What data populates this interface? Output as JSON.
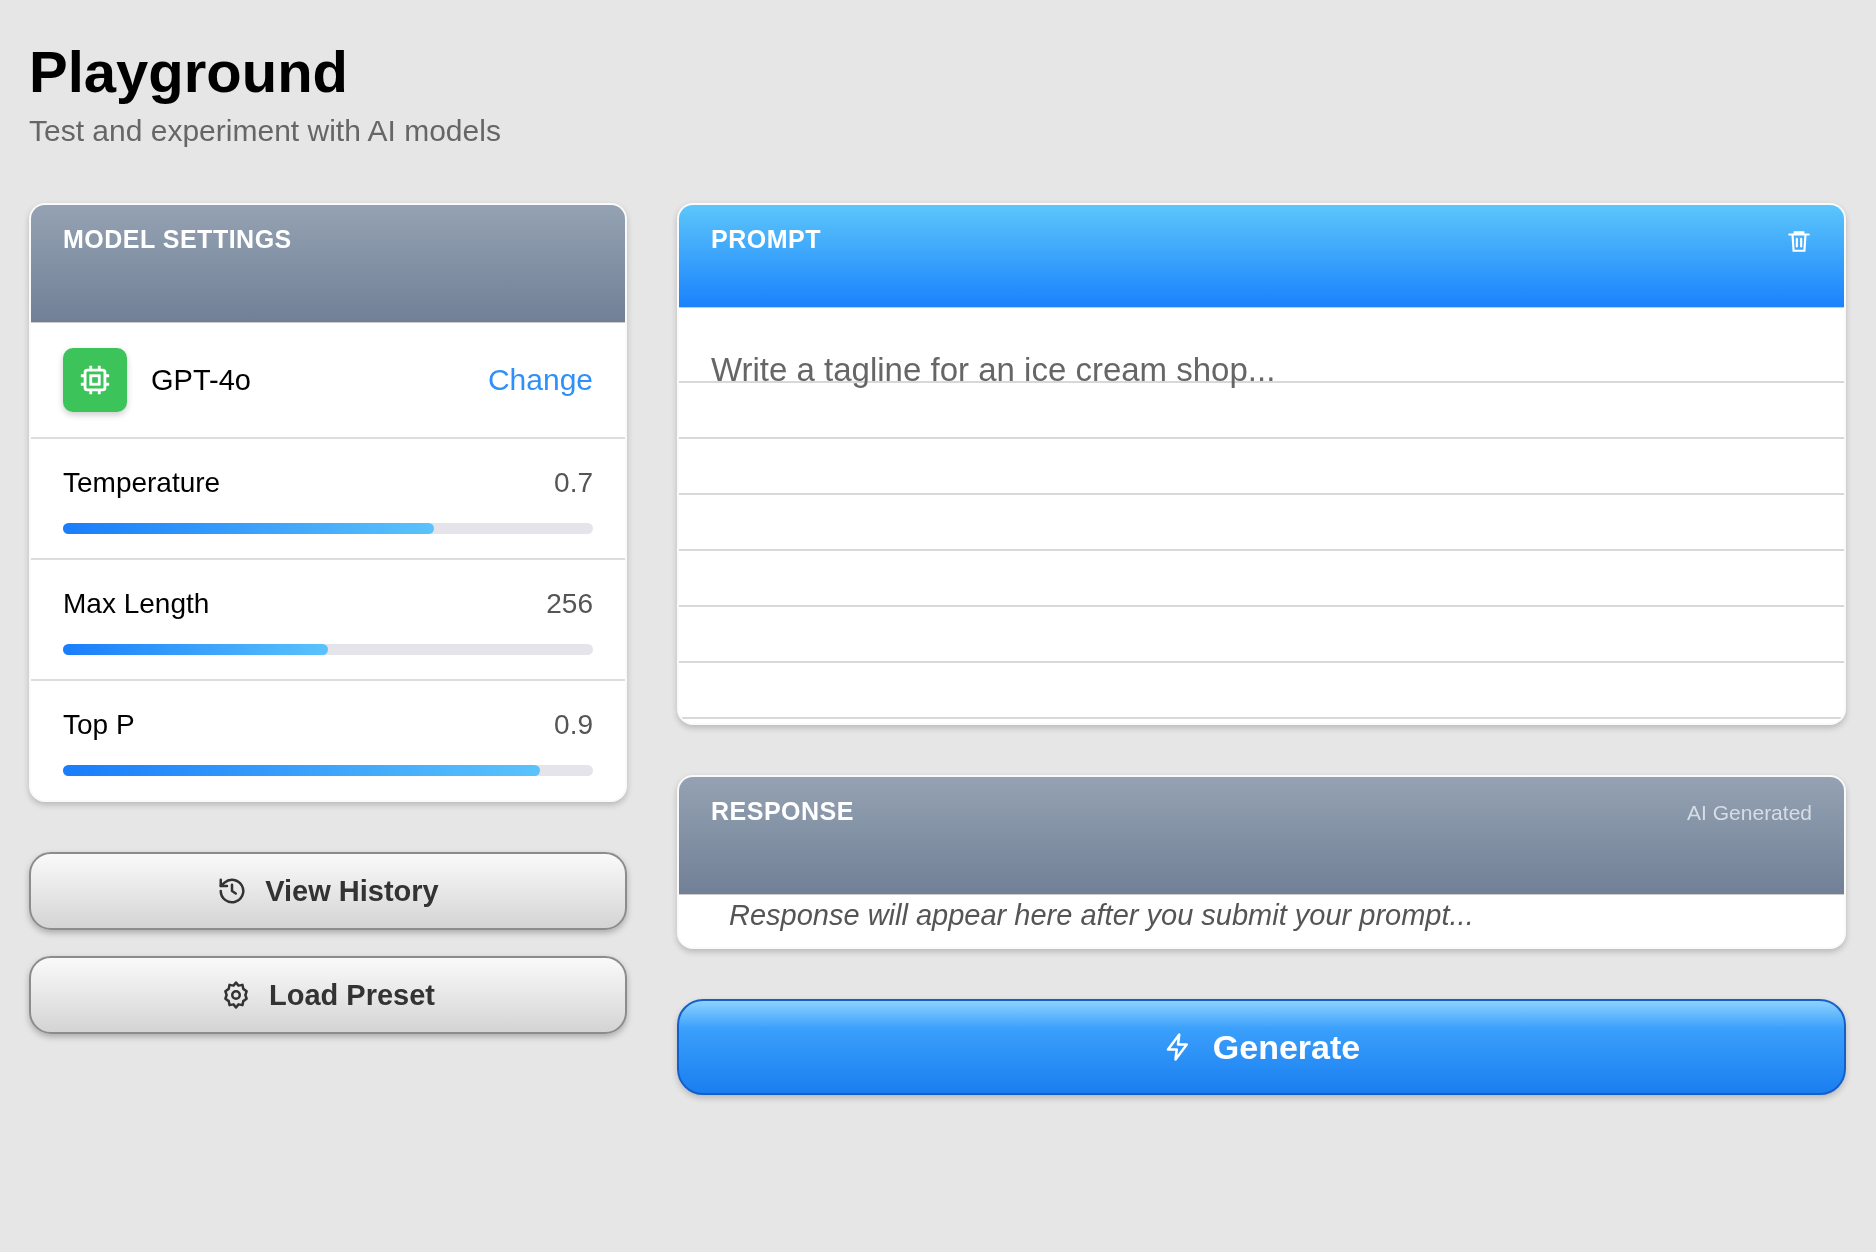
{
  "page": {
    "title": "Playground",
    "subtitle": "Test and experiment with AI models"
  },
  "model_settings": {
    "title": "MODEL SETTINGS",
    "model": {
      "name": "GPT-4o",
      "action": "Change"
    },
    "sliders": [
      {
        "label": "Temperature",
        "reading": "0.7",
        "level": 0.7
      },
      {
        "label": "Max Length",
        "reading": "256",
        "level": 0.5
      },
      {
        "label": "Top P",
        "reading": "0.9",
        "level": 0.9
      }
    ]
  },
  "side_buttons": [
    {
      "label": "View History"
    },
    {
      "label": "Load Preset"
    }
  ],
  "prompt": {
    "title": "PROMPT",
    "placeholder": "Write a tagline for an ice cream shop..."
  },
  "response": {
    "title": "RESPONSE",
    "badge": "AI Generated",
    "text": "Response will appear here after you submit your prompt..."
  },
  "generate_button": {
    "label": "Generate"
  }
}
